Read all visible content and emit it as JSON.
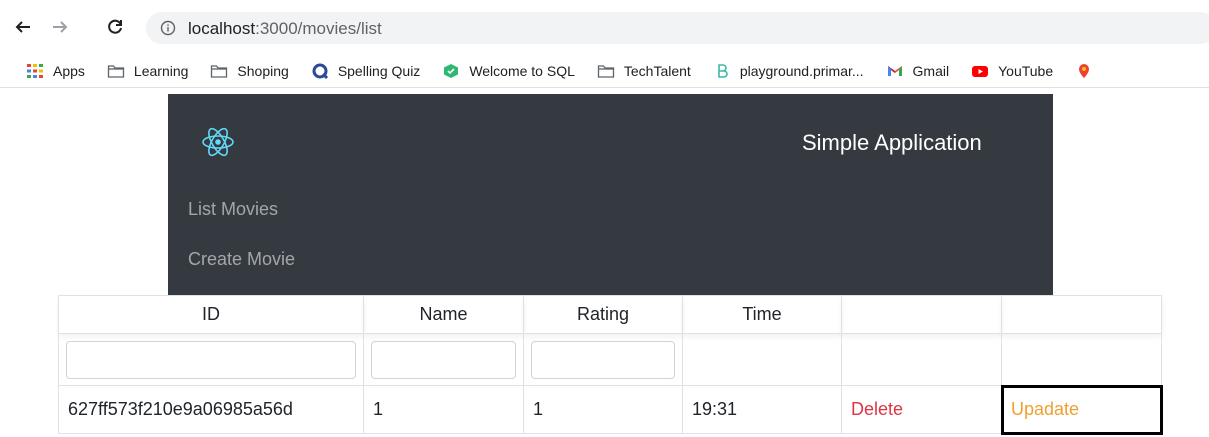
{
  "browser": {
    "url_host": "localhost",
    "url_path": ":3000/movies/list",
    "bookmarks": [
      {
        "label": "Apps",
        "icon": "apps-grid-icon"
      },
      {
        "label": "Learning",
        "icon": "folder-icon"
      },
      {
        "label": "Shoping",
        "icon": "folder-icon"
      },
      {
        "label": "Spelling Quiz",
        "icon": "quiz-icon"
      },
      {
        "label": "Welcome to SQL",
        "icon": "sql-icon"
      },
      {
        "label": "TechTalent",
        "icon": "folder-icon"
      },
      {
        "label": "playground.primar...",
        "icon": "playground-icon"
      },
      {
        "label": "Gmail",
        "icon": "gmail-icon"
      },
      {
        "label": "YouTube",
        "icon": "youtube-icon"
      }
    ]
  },
  "app": {
    "brand": "Simple Application",
    "nav": {
      "list_movies": "List Movies",
      "create_movie": "Create Movie"
    }
  },
  "table": {
    "columns": [
      "ID",
      "Name",
      "Rating",
      "Time",
      "",
      ""
    ],
    "rows": [
      {
        "id": "627ff573f210e9a06985a56d",
        "name": "1",
        "rating": "1",
        "time": "19:31",
        "delete": "Delete",
        "update": "Upadate"
      }
    ]
  },
  "colors": {
    "navbar": "#343a40",
    "delete": "#dc3545",
    "update": "#f0a030"
  }
}
